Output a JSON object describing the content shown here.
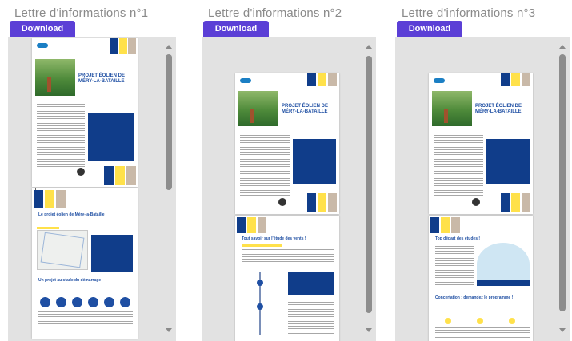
{
  "columns": [
    {
      "title": "Lettre d'informations n°1",
      "download_label": "Download"
    },
    {
      "title": "Lettre d'informations n°2",
      "download_label": "Download"
    },
    {
      "title": "Lettre d'informations n°3",
      "download_label": "Download"
    }
  ],
  "newsletter": {
    "headline_1": "PROJET ÉOLIEN DE",
    "headline_2": "MÉRY-LA-BATAILLE",
    "col1_page2_title": "Le projet éolien de Méry-la-Bataille",
    "col1_page2_sub": "Un projet au stade du démarrage",
    "col2_page2_title": "Tout savoir sur l'étude des vents !",
    "col3_page2_title": "Top départ des études !",
    "col3_page2_sub": "Concertation : demandez le programme !"
  },
  "colors": {
    "download_button": "#5b3fd6",
    "brand_blue": "#1f4fa3",
    "navy": "#103d8a",
    "yellow": "#ffe14a",
    "beige": "#c9b9a8"
  }
}
